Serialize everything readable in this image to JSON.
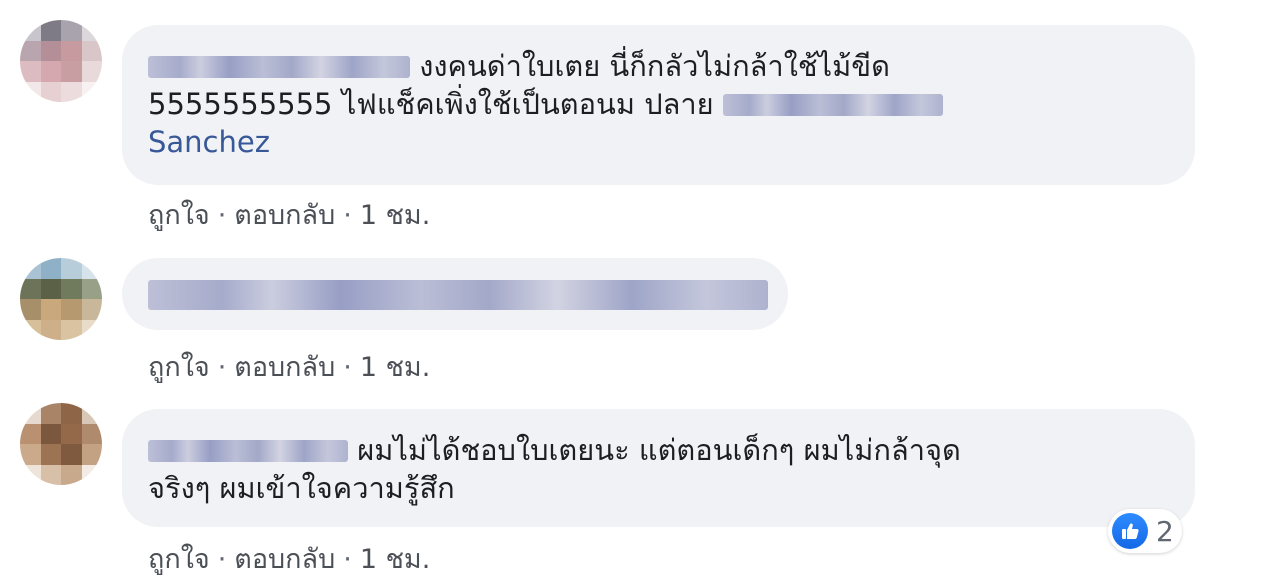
{
  "comments": [
    {
      "text_after_name": "งงคนด่าใบเตย นี่ก็กลัวไม่กล้าใช้ไม้ขีด",
      "text_line2": "5555555555 ไฟแช็คเพิ่งใช้เป็นตอนม ปลาย",
      "mention_tail": "Sanchez",
      "like_label": "ถูกใจ",
      "reply_label": "ตอบกลับ",
      "time": "1 ชม."
    },
    {
      "like_label": "ถูกใจ",
      "reply_label": "ตอบกลับ",
      "time": "1 ชม."
    },
    {
      "text_after_name": "ผมไม่ได้ชอบใบเตยนะ แต่ตอนเด็กๆ ผมไม่กล้าจุด",
      "text_line2": "จริงๆ ผมเข้าใจความรู้สึก",
      "like_label": "ถูกใจ",
      "reply_label": "ตอบกลับ",
      "time": "1 ชม.",
      "reaction_icon": "like-thumb-icon",
      "reaction_count": "2"
    }
  ],
  "separator": "·",
  "colors": {
    "bubble": "#f1f2f6",
    "mention": "#385898",
    "like_blue": "#1877f2",
    "action_text": "#4b4f56"
  }
}
